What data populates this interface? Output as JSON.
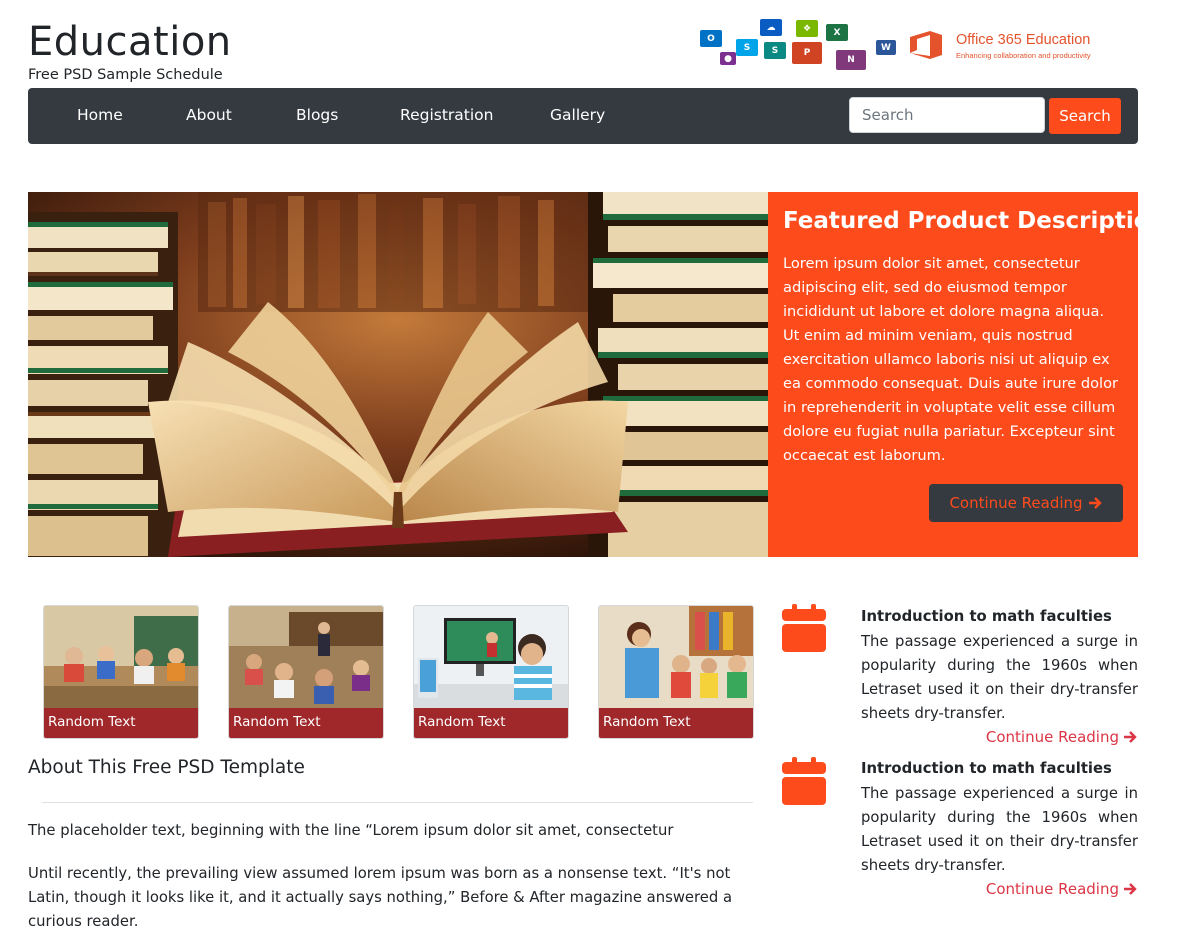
{
  "header": {
    "title": "Education",
    "subtitle": "Free PSD Sample Schedule",
    "logo": {
      "brand": "Office 365 Education",
      "tagline": "Enhancing collaboration and productivity",
      "tiles": [
        "O",
        "S",
        "X",
        "P",
        "N",
        "W"
      ]
    }
  },
  "nav": {
    "items": [
      "Home",
      "About",
      "Blogs",
      "Registration",
      "Gallery"
    ],
    "search_placeholder": "Search",
    "search_button": "Search"
  },
  "hero": {
    "title": "Featured Product Description",
    "text": "Lorem ipsum dolor sit amet, consectetur adipiscing elit, sed do eiusmod tempor incididunt ut labore et dolore magna aliqua. Ut enim ad minim veniam, quis nostrud exercitation ullamco laboris nisi ut aliquip ex ea commodo consequat. Duis aute irure dolor in reprehenderit in voluptate velit esse cillum dolore eu fugiat nulla pariatur. Excepteur sint occaecat est laborum.",
    "button": "Continue Reading"
  },
  "thumbnails": [
    {
      "caption": "Random Text"
    },
    {
      "caption": "Random Text"
    },
    {
      "caption": "Random Text"
    },
    {
      "caption": "Random Text"
    }
  ],
  "about": {
    "title": "About This Free PSD Template",
    "p1": "The placeholder text, beginning with the line “Lorem ipsum dolor sit amet, consectetur",
    "p2": "Until recently, the prevailing view assumed lorem ipsum was born as a nonsense text. “It's not Latin, though it looks like it, and it actually says nothing,” Before & After magazine answered a curious reader."
  },
  "articles": [
    {
      "title": "Introduction to math faculties",
      "text": "The passage experienced a surge in popularity during the 1960s when Letraset used it on their dry-transfer sheets dry-transfer.",
      "link": "Continue Reading"
    },
    {
      "title": "Introduction to math faculties",
      "text": "The passage experienced a surge in popularity during the 1960s when Letraset used it on their dry-transfer sheets dry-transfer.",
      "link": "Continue Reading"
    }
  ],
  "colors": {
    "accent": "#fd4b1c",
    "navbar": "#343a40",
    "caption": "#a0272a",
    "link": "#dc3545"
  }
}
